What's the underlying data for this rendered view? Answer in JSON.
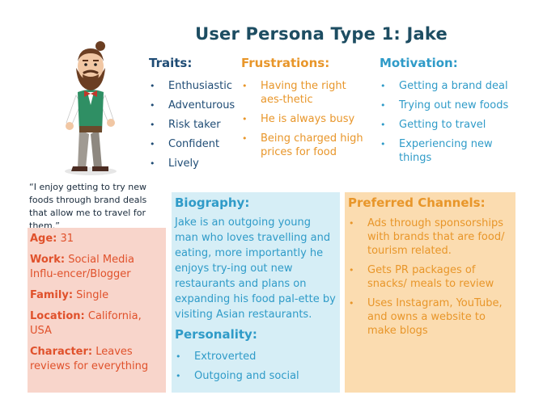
{
  "title": "User Persona Type 1: Jake",
  "traits": {
    "heading": "Traits:",
    "items": [
      "Enthusiastic",
      "Adventurous",
      "Risk taker",
      "Confident",
      "Lively"
    ]
  },
  "frustrations": {
    "heading": "Frustrations:",
    "items": [
      "Having the right aes-thetic",
      "He is always busy",
      "Being charged high prices for food"
    ]
  },
  "motivation": {
    "heading": "Motivation:",
    "items": [
      "Getting a brand deal",
      "Trying out new foods",
      "Getting to travel",
      "Experiencing new things"
    ]
  },
  "quote": "“I enjoy getting to try new foods through brand deals that allow me to travel for them.”",
  "profile": {
    "age_label": "Age:",
    "age": "31",
    "work_label": "Work:",
    "work": "Social Media Influ-encer/Blogger",
    "family_label": "Family:",
    "family": "Single",
    "location_label": "Location:",
    "location": "California, USA",
    "character_label": "Character:",
    "character": "Leaves reviews for everything"
  },
  "biography": {
    "heading": "Biography:",
    "text": "Jake is an outgoing young man who loves travelling and eating, more importantly he enjoys try-ing out new restaurants and plans on expanding his food pal-ette by visiting Asian restaurants."
  },
  "personality": {
    "heading": "Personality:",
    "items": [
      "Extroverted",
      "Outgoing and social"
    ]
  },
  "channels": {
    "heading": "Preferred Channels:",
    "items": [
      "Ads through sponsorships with brands that are food/ tourism related.",
      "Gets PR packages of snacks/ meals to review",
      "Uses Instagram, YouTube, and owns a website to make blogs"
    ]
  },
  "colors": {
    "title": "#1d4d62",
    "navy": "#1f4c75",
    "orange": "#e8962a",
    "blue": "#2f9bc8",
    "red": "#e0512b",
    "red_box": "#f8d5cb",
    "blue_box": "#d6eef6",
    "orange_box": "#fbdcb0"
  }
}
